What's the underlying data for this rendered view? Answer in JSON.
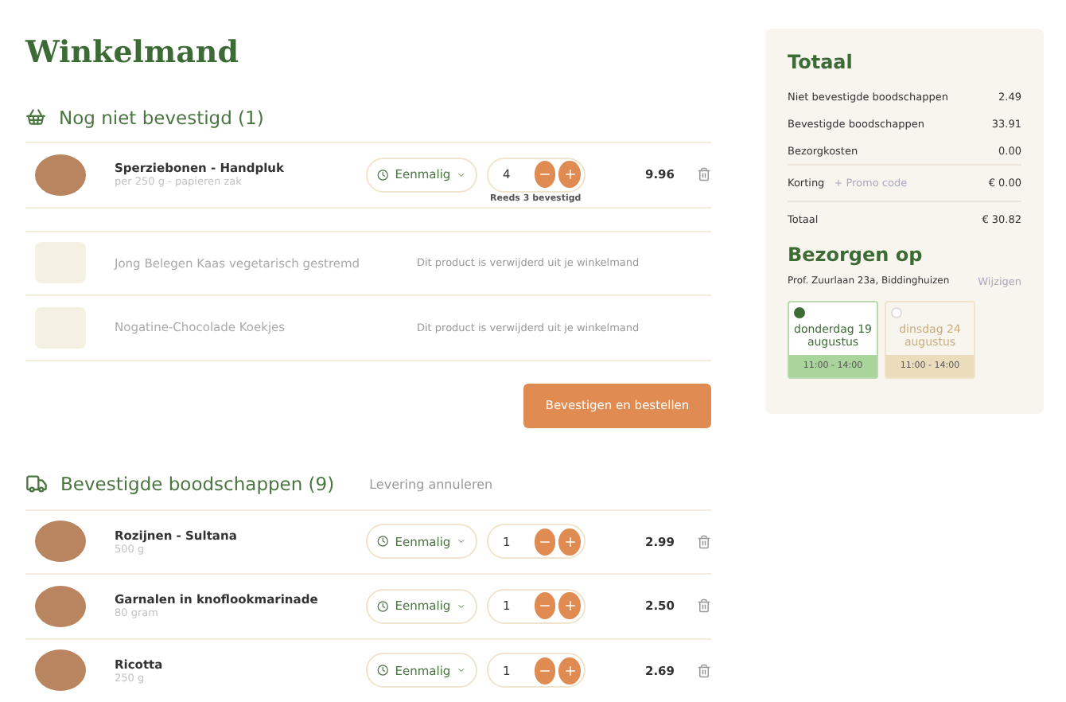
{
  "title": "Winkelmand",
  "pending": {
    "heading": "Nog niet bevestigd (1)",
    "items": [
      {
        "kind": "active",
        "name": "Sperziebonen - Handpluk",
        "sub": "per 250 g - papieren zak",
        "frequency": "Eenmalig",
        "qty": "4",
        "note": "Reeds 3 bevestigd",
        "price": "9.96"
      },
      {
        "kind": "removed",
        "name": "Jong Belegen Kaas vegetarisch gestremd",
        "message": "Dit product is verwijderd uit je winkelmand"
      },
      {
        "kind": "removed",
        "name": "Nogatine-Chocolade Koekjes",
        "message": "Dit product is verwijderd uit je winkelmand"
      }
    ],
    "button": "Bevestigen en bestellen"
  },
  "confirmed": {
    "heading": "Bevestigde boodschappen (9)",
    "link": "Levering annuleren",
    "items": [
      {
        "kind": "active",
        "name": "Rozijnen - Sultana",
        "sub": "500 g",
        "frequency": "Eenmalig",
        "qty": "1",
        "price": "2.99"
      },
      {
        "kind": "active",
        "name": "Garnalen in knoflookmarinade",
        "sub": "80 gram",
        "frequency": "Eenmalig",
        "qty": "1",
        "price": "2.50"
      },
      {
        "kind": "active",
        "name": "Ricotta",
        "sub": "250 g",
        "frequency": "Eenmalig",
        "qty": "1",
        "price": "2.69"
      }
    ]
  },
  "summary": {
    "title": "Totaal",
    "lines": [
      {
        "label": "Niet bevestigde boodschappen",
        "value": "2.49"
      },
      {
        "label": "Bevestigde boodschappen",
        "value": "33.91"
      },
      {
        "label": "Bezorgkosten",
        "value": "0.00"
      }
    ],
    "discount": {
      "label": "Korting",
      "link": "+ Promo code",
      "value": "€ 0.00"
    },
    "total": {
      "label": "Totaal",
      "value": "€ 30.82"
    }
  },
  "delivery": {
    "title": "Bezorgen op",
    "address": "Prof. Zuurlaan 23a, Biddinghuizen",
    "change": "Wijzigen",
    "slots": [
      {
        "day": "donderdag 19 augustus",
        "time": "11:00 - 14:00",
        "selected": true
      },
      {
        "day": "dinsdag 24 augustus",
        "time": "11:00 - 14:00",
        "selected": false
      }
    ]
  }
}
